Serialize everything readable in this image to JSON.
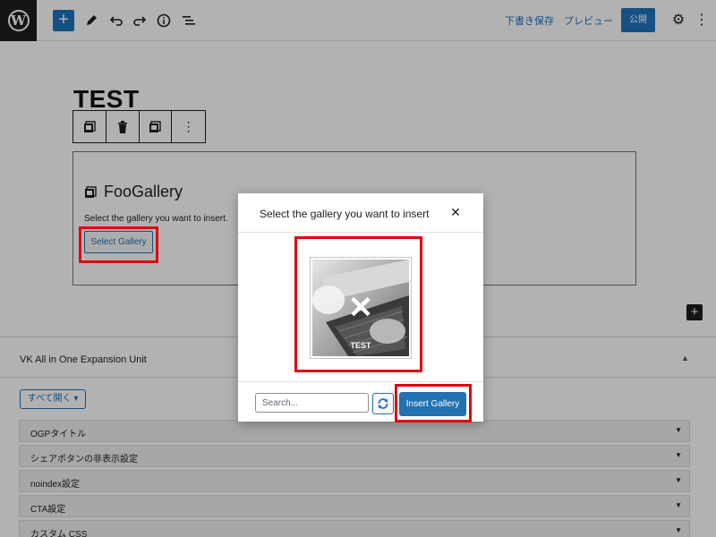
{
  "topbar": {
    "add_icon": "plus-icon",
    "tools": [
      "pencil-icon",
      "undo-icon",
      "redo-icon",
      "info-icon",
      "list-view-icon"
    ],
    "save_draft": "下書き保存",
    "preview": "プレビュー",
    "publish": "公開"
  },
  "editor": {
    "post_title": "TEST",
    "block_toolbar_icons": [
      "gallery-icon",
      "trash-icon",
      "gallery-icon",
      "more-options-icon"
    ],
    "block": {
      "title": "FooGallery",
      "description": "Select the gallery you want to insert.",
      "select_button": "Select Gallery"
    }
  },
  "meta_panel": {
    "title": "VK All in One Expansion Unit",
    "open_all_button": "すべて開く",
    "rows": [
      {
        "label": "OGPタイトル"
      },
      {
        "label": "シェアボタンの非表示設定"
      },
      {
        "label": "noindex設定"
      },
      {
        "label": "CTA設定"
      },
      {
        "label": "カスタム CSS"
      }
    ]
  },
  "modal": {
    "title": "Select the gallery you want to insert",
    "gallery_items": [
      {
        "label": "TEST"
      }
    ],
    "search_placeholder": "Search...",
    "search_value": "",
    "insert_button": "Insert Gallery"
  },
  "colors": {
    "accent": "#1e73be",
    "button_blue": "#2271b1",
    "highlight": "#e1000f"
  }
}
